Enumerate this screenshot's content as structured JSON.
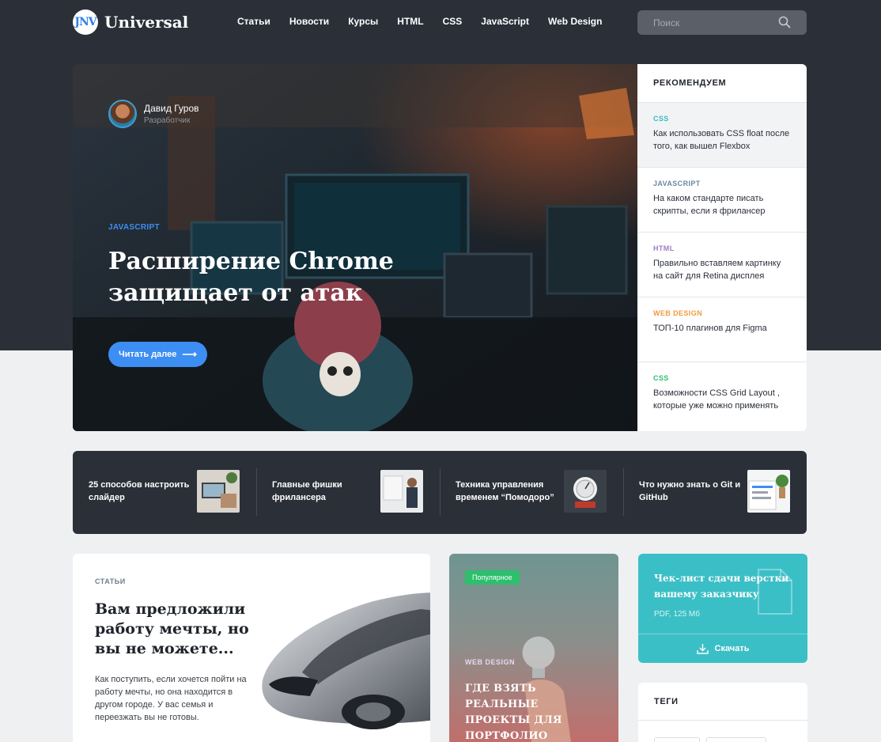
{
  "header": {
    "logo_mark": "JNV",
    "logo_text": "Universal",
    "nav": [
      "Статьи",
      "Новости",
      "Курсы",
      "HTML",
      "CSS",
      "JavaScript",
      "Web Design"
    ],
    "search_placeholder": "Поиск"
  },
  "hero": {
    "author_name": "Давид Гуров",
    "author_role": "Разработчик",
    "category": "JAVASCRIPT",
    "title": "Расширение Chrome защищает от атак",
    "button": "Читать далее"
  },
  "recommend": {
    "title": "РЕКОМЕНДУЕМ",
    "items": [
      {
        "category": "CSS",
        "color": "#38bcc4",
        "title": "Как использовать CSS float после того, как вышел Flexbox"
      },
      {
        "category": "JAVASCRIPT",
        "color": "#6b87a6",
        "title": "На каком стандарте писать скрипты, если я фрилансер"
      },
      {
        "category": "HTML",
        "color": "#9b7dc6",
        "title": "Правильно вставляем картинку на сайт для Retina дисплея"
      },
      {
        "category": "WEB DESIGN",
        "color": "#f29a3f",
        "title": "ТОП-10 плагинов для Figma"
      },
      {
        "category": "CSS",
        "color": "#2fbf6f",
        "title": "Возможности CSS Grid Layout , которые уже можно применять"
      }
    ]
  },
  "strip": [
    {
      "title": "25 способов настроить слайдер"
    },
    {
      "title": "Главные фишки фрилансера"
    },
    {
      "title": "Техника управления временем “Помодоро”"
    },
    {
      "title": "Что нужно знать о Git и GitHub"
    }
  ],
  "article": {
    "category": "СТАТЬИ",
    "title": "Вам предложили работу мечты, но вы не можете...",
    "text": "Как поступить, если хочется пойти на работу мечты, но она находится в другом городе. У вас семья и переезжать вы не готовы."
  },
  "popular": {
    "badge": "Популярное",
    "category": "WEB DESIGN",
    "title": "ГДЕ ВЗЯТЬ РЕАЛЬНЫЕ ПРОЕКТЫ ДЛЯ ПОРТФОЛИО"
  },
  "checklist": {
    "title": "Чек-лист сдачи верстки вашему заказчику",
    "meta": "PDF, 125 Мб",
    "download": "Скачать"
  },
  "tags": {
    "title": "ТЕГИ"
  }
}
